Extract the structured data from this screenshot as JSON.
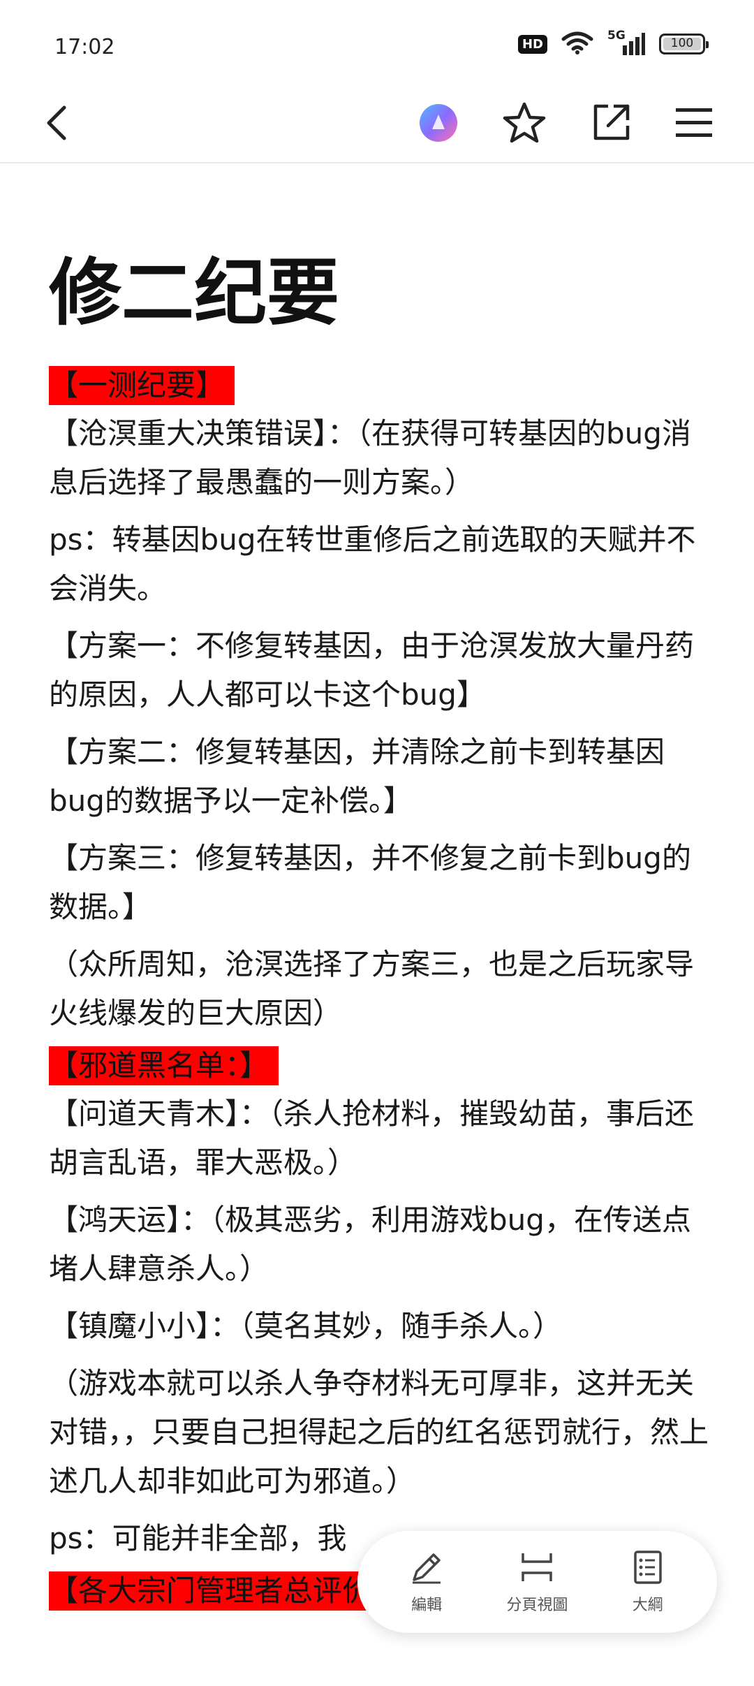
{
  "status_bar": {
    "time": "17:02",
    "hd_label": "HD",
    "network_label": "5G",
    "battery_percent": 100,
    "battery_text": "100"
  },
  "nav": {
    "back_icon": "chevron-left-icon",
    "assistant_icon": "assistant-orb-icon",
    "favorite_icon": "star-icon",
    "share_icon": "external-link-icon",
    "menu_icon": "menu-icon"
  },
  "article": {
    "title": "修二纪要",
    "blocks": [
      {
        "type": "highlight",
        "text": "【一测纪要】"
      },
      {
        "type": "para",
        "text": "【沧溟重大决策错误】：（在获得可转基因的bug消息后选择了最愚蠢的一则方案。）"
      },
      {
        "type": "para",
        "text": "ps：转基因bug在转世重修后之前选取的天赋并不会消失。"
      },
      {
        "type": "para",
        "text": "【方案一：不修复转基因，由于沧溟发放大量丹药的原因，人人都可以卡这个bug】"
      },
      {
        "type": "para",
        "text": "【方案二：修复转基因，并清除之前卡到转基因bug的数据予以一定补偿。】"
      },
      {
        "type": "para",
        "text": "【方案三：修复转基因，并不修复之前卡到bug的数据。】"
      },
      {
        "type": "para",
        "text": "（众所周知，沧溟选择了方案三，也是之后玩家导火线爆发的巨大原因）"
      },
      {
        "type": "highlight",
        "text": "【邪道黑名单：】"
      },
      {
        "type": "para",
        "text": "【问道天青木】：（杀人抢材料，摧毁幼苗，事后还胡言乱语，罪大恶极。）"
      },
      {
        "type": "para",
        "text": "【鸿天运】：（极其恶劣，利用游戏bug，在传送点堵人肆意杀人。）"
      },
      {
        "type": "para",
        "text": "【镇魔小小】：（莫名其妙，随手杀人。）"
      },
      {
        "type": "para",
        "text": "（游戏本就可以杀人争夺材料无可厚非，这并无关对错，，只要自己担得起之后的红名惩罚就行，然上述几人却非如此可为邪道。）"
      },
      {
        "type": "para",
        "text": "ps：可能并非全部，我"
      },
      {
        "type": "highlight",
        "text": "【各大宗门管理者总评价：】"
      }
    ]
  },
  "toolbar": {
    "edit_label": "編輯",
    "split_label": "分頁視圖",
    "outline_label": "大綱",
    "edit_icon": "pencil-icon",
    "split_icon": "split-view-icon",
    "outline_icon": "outline-list-icon"
  }
}
